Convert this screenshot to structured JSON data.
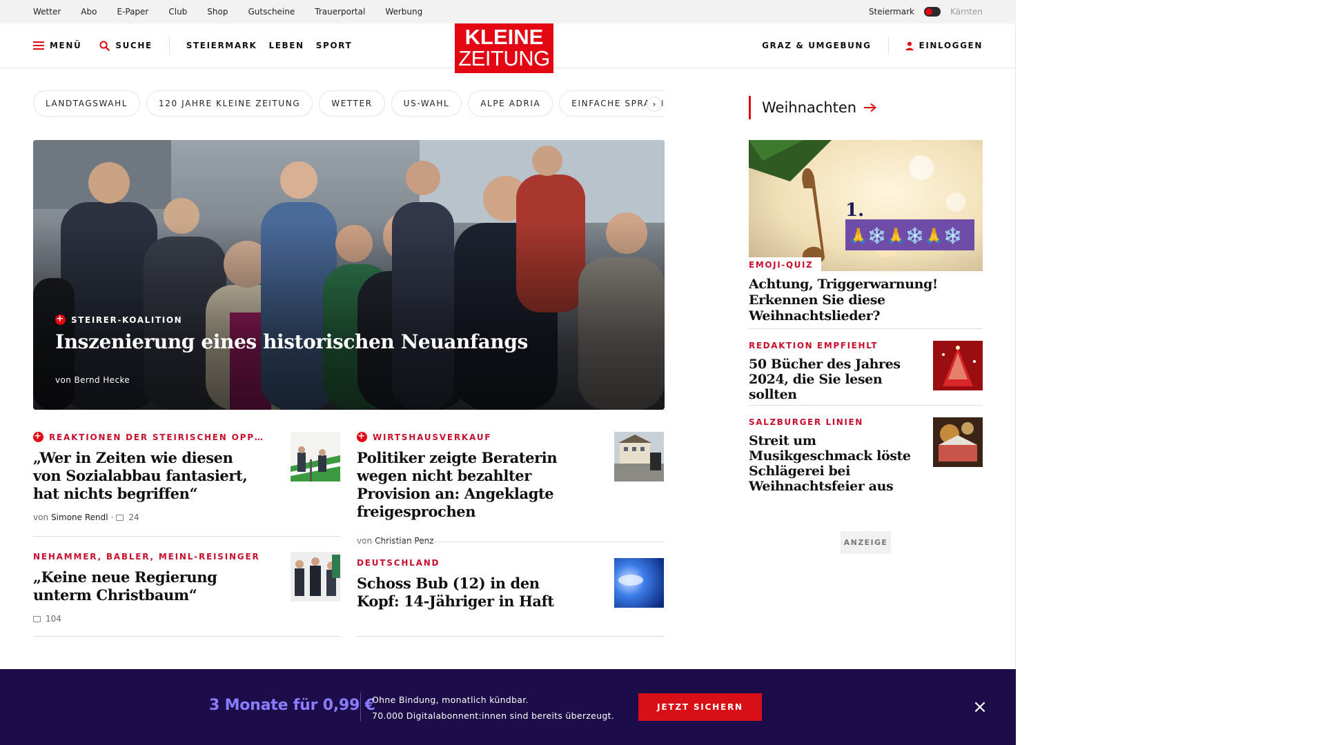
{
  "topbar": {
    "links": [
      "Wetter",
      "Abo",
      "E-Paper",
      "Club",
      "Shop",
      "Gutscheine",
      "Trauerportal",
      "Werbung"
    ],
    "region_active": "Steiermark",
    "region_inactive": "Kärnten"
  },
  "header": {
    "menu_label": "MENÜ",
    "search_label": "SUCHE",
    "nav": [
      "STEIERMARK",
      "LEBEN",
      "SPORT"
    ],
    "logo_line1": "KLEINE",
    "logo_line2": "ZEITUNG",
    "local_label": "GRAZ & UMGEBUNG",
    "login_label": "EINLOGGEN"
  },
  "topics": [
    "LANDTAGSWAHL",
    "120 JAHRE KLEINE ZEITUNG",
    "WETTER",
    "US-WAHL",
    "ALPE ADRIA",
    "EINFACHE SPRACHE"
  ],
  "hero": {
    "kicker": "STEIRER-KOALITION",
    "title": "Inszenierung eines historischen Neuanfangs",
    "author": "von Bernd Hecke"
  },
  "articles": [
    {
      "kicker": "REAKTIONEN DER STEIRISCHEN OPP…",
      "title": "„Wer in Zeiten wie diesen von Sozialabbau fantasiert, hat nichts begriffen“",
      "author_prefix": "von",
      "author": "Simone Rendl",
      "comments": "24",
      "plus": true
    },
    {
      "kicker": "WIRTSHAUSVERKAUF",
      "title": "Politiker zeigte Beraterin wegen nicht bezahlter Provision an: Angeklagte freigesprochen",
      "author_prefix": "von",
      "author": "Christian Penz",
      "plus": true
    },
    {
      "kicker": "NEHAMMER, BABLER, MEINL-REISINGER",
      "title": "„Keine neue Regierung unterm Christbaum“",
      "comments": "104"
    },
    {
      "kicker": "DEUTSCHLAND",
      "title": "Schoss Bub (12) in den Kopf: 14-Jähriger in Haft"
    }
  ],
  "sidebar": {
    "heading": "Weihnachten",
    "feature": {
      "kicker": "EMOJI-QUIZ",
      "title": "Achtung, Triggerwarnung! Erkennen Sie diese Weihnachtslieder?",
      "number": "1.",
      "emojis": "🙏❄️🙏❄️🙏❄️"
    },
    "items": [
      {
        "kicker": "REDAKTION EMPFIEHLT",
        "title": "50 Bücher des Jahres 2024, die Sie lesen sollten"
      },
      {
        "kicker": "SALZBURGER LINIEN",
        "title": "Streit um Musikgeschmack löste Schlägerei bei Weihnachtsfeier aus"
      }
    ],
    "ad_label": "ANZEIGE"
  },
  "promo": {
    "price": "3 Monate für 0,99 €",
    "line1": "Ohne Bindung, monatlich kündbar.",
    "line2": "70.000 Digitalabonnent:innen sind bereits überzeugt.",
    "button": "JETZT SICHERN"
  },
  "colors": {
    "brand_red": "#e30613",
    "promo_bg": "#1d0c4a",
    "promo_price": "#8a7cff"
  }
}
